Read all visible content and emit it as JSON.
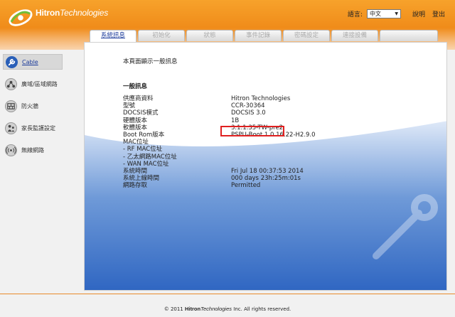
{
  "header": {
    "brand_bold": "Hitron",
    "brand_italic": "Technologies",
    "language_label": "語言:",
    "language_selected": "中文",
    "help_label": "說明",
    "logout_label": "登出"
  },
  "tabs": [
    {
      "label": "系統訊息",
      "active": true
    },
    {
      "label": "初始化"
    },
    {
      "label": "狀態"
    },
    {
      "label": "事件記錄"
    },
    {
      "label": "密碼設定"
    },
    {
      "label": "連接設備"
    }
  ],
  "sidebar": {
    "items": [
      {
        "label": "Cable",
        "icon": "wrench-icon",
        "active": true
      },
      {
        "label": "廣域/區域網路",
        "icon": "network-icon"
      },
      {
        "label": "防火牆",
        "icon": "firewall-icon"
      },
      {
        "label": "家長監護設定",
        "icon": "parental-control-icon"
      },
      {
        "label": "無線網路",
        "icon": "wireless-icon"
      }
    ]
  },
  "main": {
    "intro": "本頁面顯示一般訊息",
    "section_title": "一般訊息",
    "rows": [
      {
        "label": "供應商資料",
        "value": "Hitron Technologies"
      },
      {
        "label": "型號",
        "value": "CCR-30364"
      },
      {
        "label": "DOCSIS模式",
        "value": "DOCSIS 3.0"
      },
      {
        "label": "硬體版本",
        "value": "1B"
      },
      {
        "label": "軟體版本",
        "value": "3.1.1.35-TW-pre2"
      },
      {
        "label": "Boot Rom版本",
        "value": "PSPU-Boot 1.0.16.22-H2.9.0"
      },
      {
        "label": "MAC位址",
        "value": ""
      },
      {
        "label": "- RF MAC位址",
        "value": ""
      },
      {
        "label": "- 乙太網路MAC位址",
        "value": ""
      },
      {
        "label": "- WAN MAC位址",
        "value": ""
      },
      {
        "label": "系統時間",
        "value": "Fri Jul 18 00:37:53 2014"
      },
      {
        "label": "系統上線時間",
        "value": "000 days 23h:25m:01s"
      },
      {
        "label": "網路存取",
        "value": "Permitted"
      }
    ]
  },
  "footer": {
    "prefix": "© 2011",
    "brand_bold": "Hitron",
    "brand_italic": "Technologies",
    "suffix": "Inc.  All rights reserved."
  },
  "colors": {
    "header_orange": "#f08c1a",
    "active_tab_text": "#1a3a9a",
    "panel_blue": "#3b72c8",
    "highlight_red": "#e02020"
  }
}
